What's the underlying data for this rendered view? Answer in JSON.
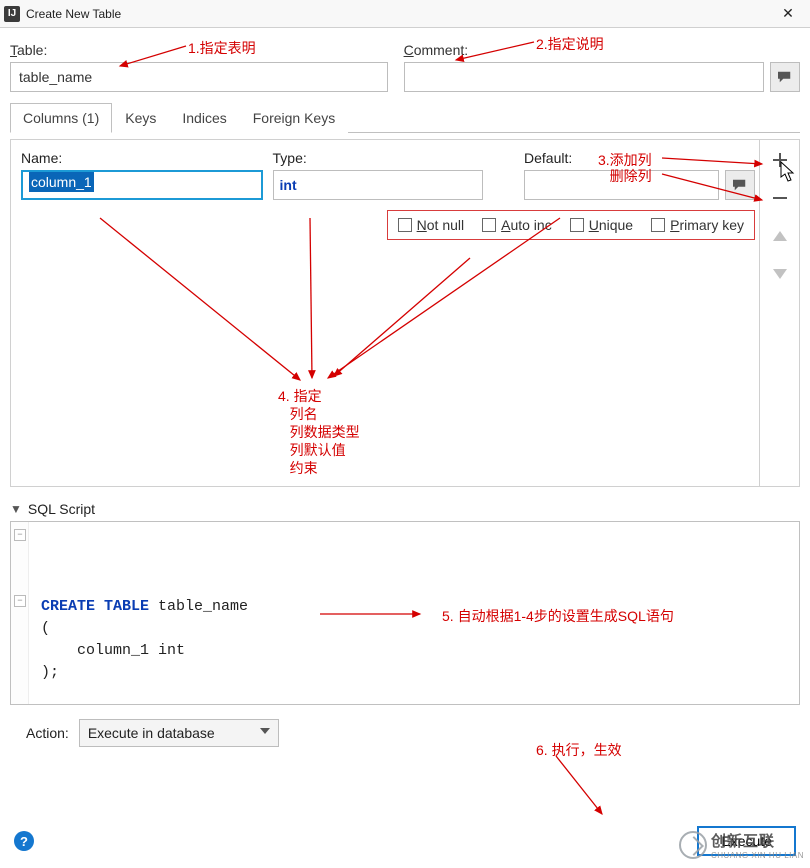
{
  "window": {
    "title": "Create New Table",
    "app_icon_text": "IJ",
    "close_glyph": "✕"
  },
  "labels": {
    "table": "able:",
    "table_prefix": "T",
    "comment": "omment:",
    "comment_prefix": "C",
    "name": "ame:",
    "name_prefix": "N",
    "type": "Type:",
    "default": "efault:",
    "default_prefix": "D",
    "sql_script": "cript",
    "sql_script_prefix": "SQL S",
    "action": "Action:"
  },
  "inputs": {
    "table_name": "table_name",
    "comment": "",
    "column_name": "column_1",
    "column_type": "int",
    "column_default": ""
  },
  "tabs": [
    {
      "label": "Columns (1)",
      "active": true
    },
    {
      "label": "Keys",
      "active": false
    },
    {
      "label": "Indices",
      "active": false
    },
    {
      "label": "Foreign Keys",
      "active": false
    }
  ],
  "constraints": {
    "not_null": {
      "prefix": "N",
      "rest": "ot null",
      "checked": false
    },
    "auto_inc": {
      "prefix": "A",
      "rest": "uto inc",
      "checked": false
    },
    "unique": {
      "prefix": "U",
      "rest": "nique",
      "checked": false
    },
    "primary": {
      "prefix": "P",
      "rest": "rimary key",
      "checked": false
    }
  },
  "sql": {
    "line1_kw": "CREATE TABLE ",
    "line1_ident": "table_name",
    "line2": "(",
    "line3": "    column_1 int",
    "line4": ");"
  },
  "action_select": "Execute in database",
  "execute_btn": "Execute",
  "annotations": {
    "a1": "1.指定表明",
    "a2": "2.指定说明",
    "a3_add": "3.添加列",
    "a3_del": "   删除列",
    "a4": "4. 指定\n   列名\n   列数据类型\n   列默认值\n   约束",
    "a5": "5. 自动根据1-4步的设置生成SQL语句",
    "a6": "6. 执行，生效"
  },
  "watermark": {
    "line1": "创新互联",
    "line2": "CHUANG XIN HU LIAN"
  }
}
